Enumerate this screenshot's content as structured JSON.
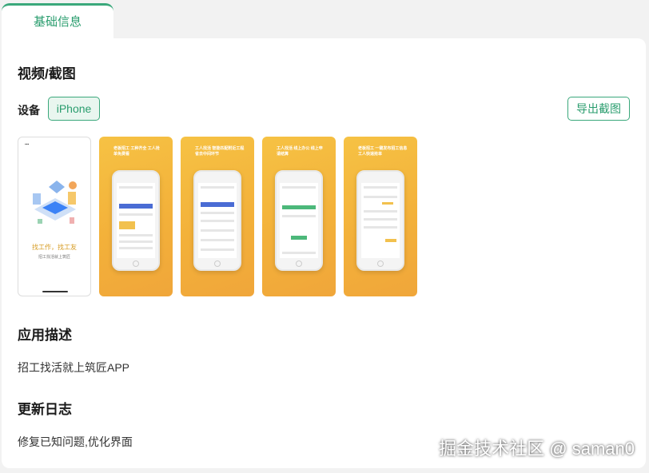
{
  "tabs": [
    {
      "label": "基础信息",
      "active": true
    }
  ],
  "screenshots_section": {
    "title": "视频/截图",
    "device_label": "设备",
    "device_selected": "iPhone",
    "export_label": "导出截图",
    "shots": [
      {
        "style": "white",
        "cta_title": "找工作，找工友",
        "cta_sub": "招工找活就上筑匠"
      },
      {
        "style": "orange",
        "promo": "老板招工 工种齐全 工人抢单免费看"
      },
      {
        "style": "orange",
        "promo": "工人找活 智能匹配附近工程 省去中间环节"
      },
      {
        "style": "orange",
        "promo": "工人找活 线上办公 线上申请结算"
      },
      {
        "style": "orange",
        "promo": "老板招工 一键发布招工信息 工人快速抢单"
      }
    ]
  },
  "description_section": {
    "title": "应用描述",
    "text": "招工找活就上筑匠APP"
  },
  "changelog_section": {
    "title": "更新日志",
    "text": "修复已知问题,优化界面"
  },
  "watermark": "掘金技术社区 @ saman0",
  "colors": {
    "accent": "#3aa87b",
    "accent_bg": "#e9f6ef",
    "promo_orange": "#f3b13a"
  }
}
